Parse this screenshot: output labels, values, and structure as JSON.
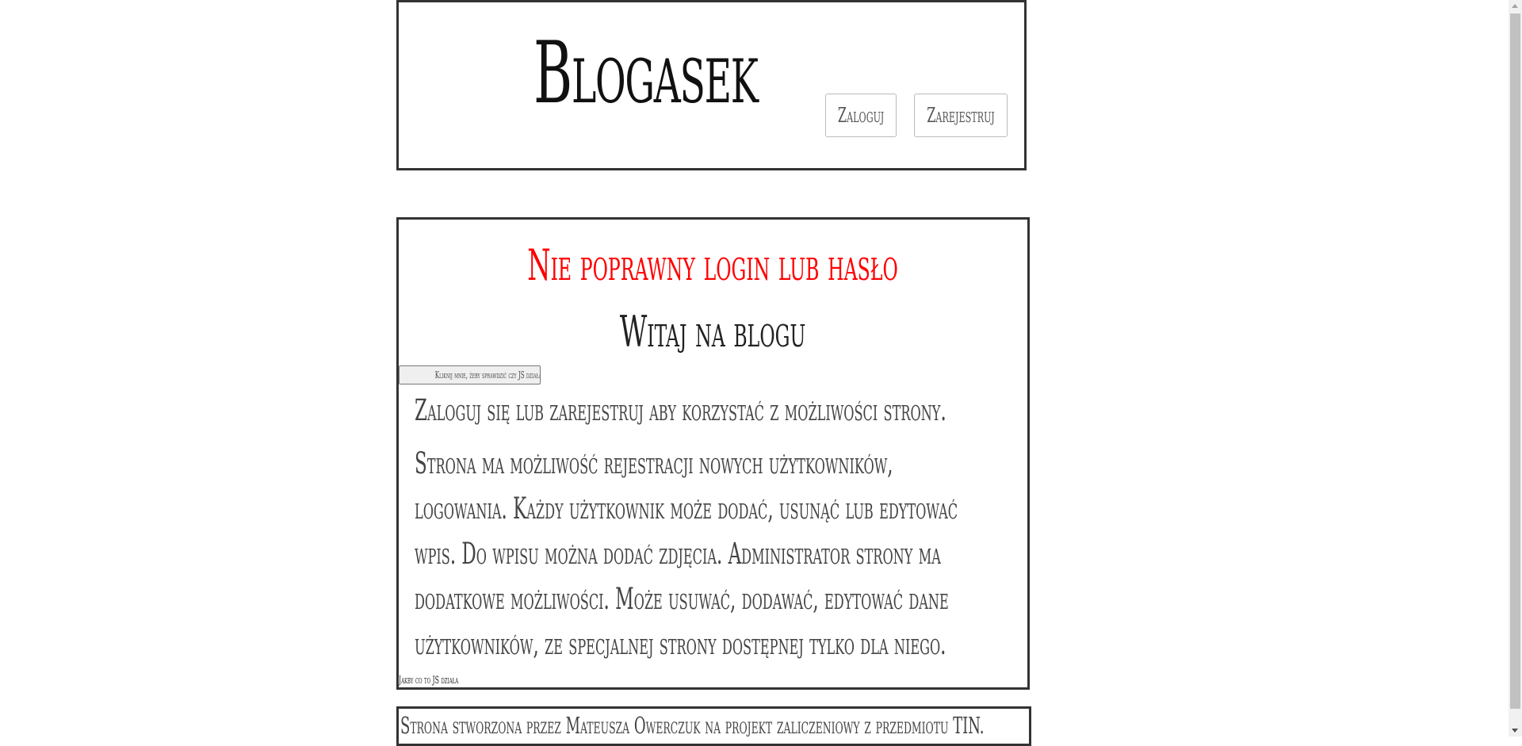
{
  "header": {
    "logo": "Blogasek",
    "login_label": "Zaloguj",
    "register_label": "Zarejestruj"
  },
  "main": {
    "error_message": "Nie poprawny login lub hasło",
    "welcome_title": "Witaj na blogu",
    "js_button_label": "Kliknij mnie, żeby sprawdzić czy JS działa",
    "intro_line": "Zaloguj się lub zarejestruj aby korzystać z możliwości strony.",
    "description_lines": [
      "Strona ma możliwość rejestracji nowych użytkowników,",
      "logowania. Każdy użytkownik może dodać, usunąć lub edytować",
      "wpis. Do wpisu można dodać zdjęcia. Administrator strony ma",
      "dodatkowe możliwości. Może usuwać, dodawać, edytować dane",
      "użytkowników, ze specjalnej strony dostępnej tylko dla niego."
    ],
    "js_note": "Jakby co to JS działa"
  },
  "footer": {
    "text": "Strona stworzona przez Mateusza Owerczuk na projekt zaliczeniowy z przedmiotu TIN."
  },
  "colors": {
    "error": "#ff0000",
    "border": "#333333"
  }
}
